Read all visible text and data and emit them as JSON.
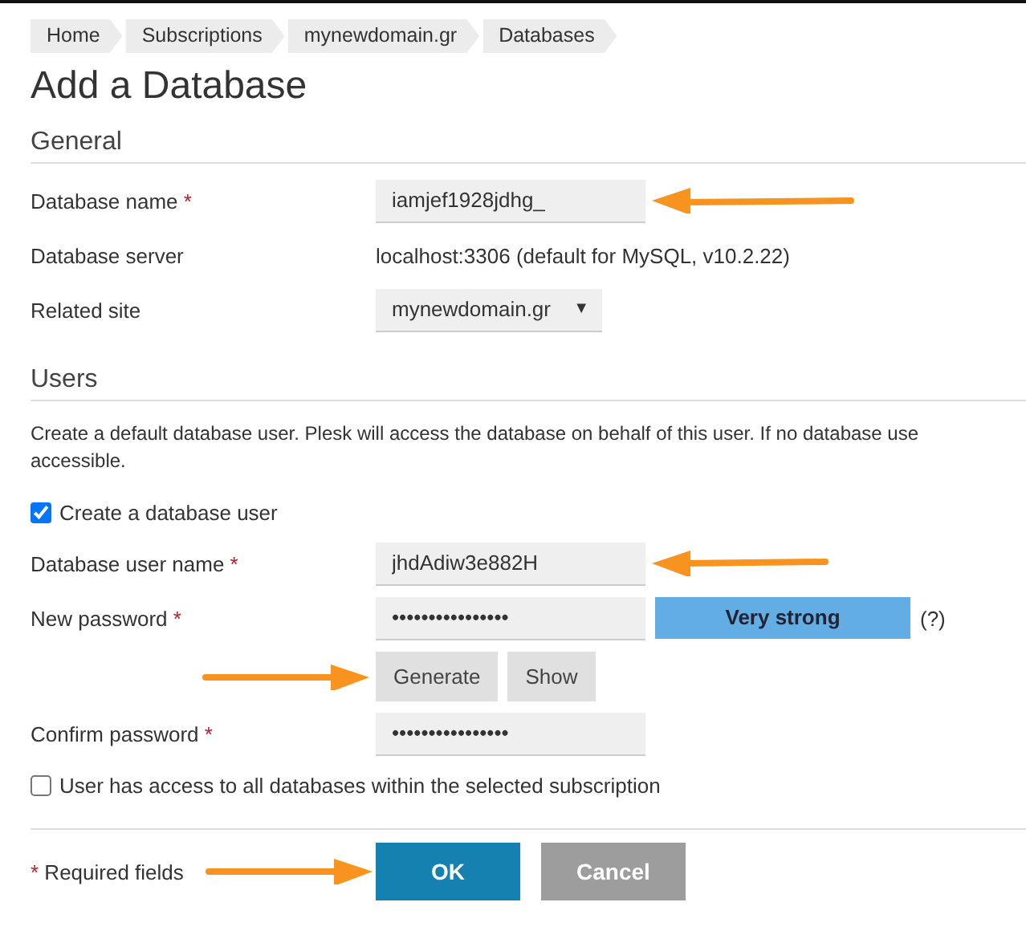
{
  "breadcrumbs": [
    "Home",
    "Subscriptions",
    "mynewdomain.gr",
    "Databases"
  ],
  "title": "Add a Database",
  "general": {
    "heading": "General",
    "rows": [
      {
        "kind": "input",
        "label": "Database name",
        "required": true,
        "value": "iamjef1928jdhg_",
        "annotated": true
      },
      {
        "kind": "text",
        "label": "Database server",
        "required": false,
        "value": "localhost:3306 (default for MySQL, v10.2.22)",
        "annotated": false
      },
      {
        "kind": "select",
        "label": "Related site",
        "required": false,
        "value": "mynewdomain.gr",
        "caret": "▼",
        "annotated": false
      }
    ]
  },
  "users": {
    "heading": "Users",
    "description_lines": [
      "Create a default database user. Plesk will access the database on behalf of this user. If no database use",
      "accessible."
    ],
    "create_user": {
      "label": "Create a database user",
      "checked": true
    },
    "user_name": {
      "label": "Database user name",
      "required": true,
      "value": "jhdAdiw3e882H",
      "annotated": true
    },
    "new_password": {
      "label": "New password",
      "required": true,
      "value": "••••••••••••••••",
      "strength": "Very strong",
      "help": "(?)"
    },
    "password_buttons": {
      "annotated": true,
      "items": [
        {
          "label": "Generate"
        },
        {
          "label": "Show"
        }
      ]
    },
    "confirm_password": {
      "label": "Confirm password",
      "required": true,
      "value": "••••••••••••••••"
    },
    "all_access": {
      "label": "User has access to all databases within the selected subscription",
      "checked": false
    }
  },
  "footer": {
    "required_mark": "*",
    "required_note": "Required fields",
    "annotated": true,
    "buttons": [
      {
        "label": "OK",
        "kind": "primary"
      },
      {
        "label": "Cancel",
        "kind": "secondary"
      }
    ]
  }
}
